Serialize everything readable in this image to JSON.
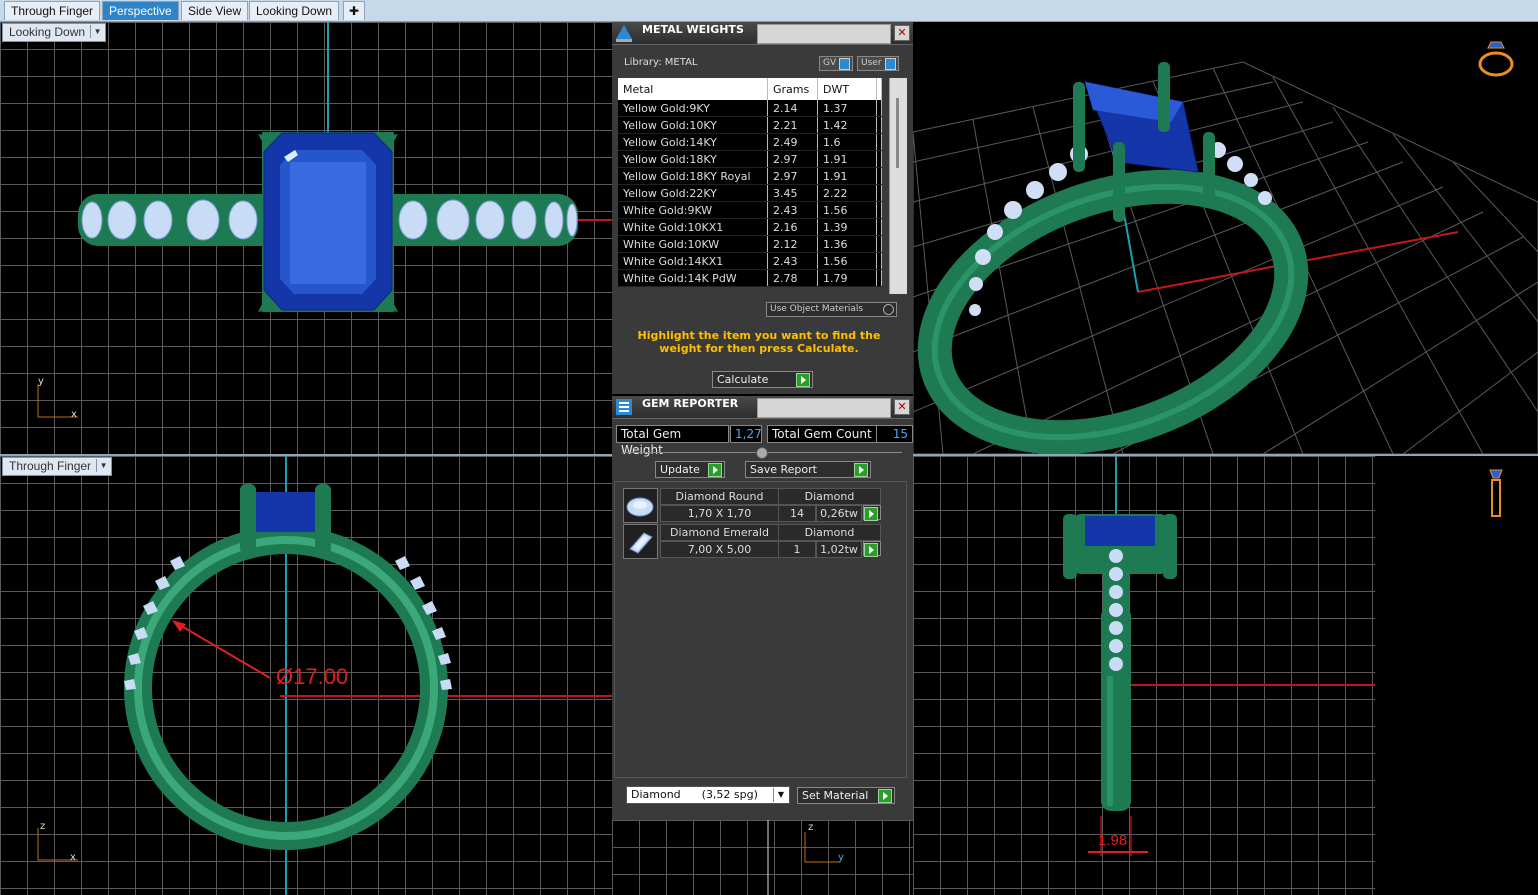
{
  "tabs": [
    {
      "label": "Through Finger",
      "active": false
    },
    {
      "label": "Perspective",
      "active": true
    },
    {
      "label": "Side View",
      "active": false
    },
    {
      "label": "Looking Down",
      "active": false
    }
  ],
  "add_tab_icon": "plus-icon",
  "viewports": {
    "top_left": {
      "label": "Looking Down",
      "axis_v": "y",
      "axis_h": "x"
    },
    "bottom_left": {
      "label": "Through Finger",
      "axis_v": "z",
      "axis_h": "x",
      "dimension": "Ø17.00"
    },
    "bottom_right": {
      "axis_v": "z",
      "axis_h": "y",
      "dimension": "1.98"
    },
    "top_right": {
      "icon": "ring-view-icon"
    }
  },
  "colors": {
    "metal": "#1e7a52",
    "gem": "#1a3fb8",
    "diamond": "#c8dcf5",
    "dimension": "#e02020",
    "axis": "#1aa0b0"
  },
  "metal_weights": {
    "title": "METAL WEIGHTS",
    "library": "Library: METAL",
    "gv_label": "GV",
    "user_label": "User",
    "columns": [
      "Metal",
      "Grams",
      "DWT"
    ],
    "rows": [
      [
        "Yellow Gold:9KY",
        "2.14",
        "1.37"
      ],
      [
        "Yellow Gold:10KY",
        "2.21",
        "1.42"
      ],
      [
        "Yellow Gold:14KY",
        "2.49",
        "1.6"
      ],
      [
        "Yellow Gold:18KY",
        "2.97",
        "1.91"
      ],
      [
        "Yellow Gold:18KY Royal",
        "2.97",
        "1.91"
      ],
      [
        "Yellow Gold:22KY",
        "3.45",
        "2.22"
      ],
      [
        "White Gold:9KW",
        "2.43",
        "1.56"
      ],
      [
        "White Gold:10KX1",
        "2.16",
        "1.39"
      ],
      [
        "White Gold:10KW",
        "2.12",
        "1.36"
      ],
      [
        "White Gold:14KX1",
        "2.43",
        "1.56"
      ],
      [
        "White Gold:14K PdW",
        "2.78",
        "1.79"
      ]
    ],
    "use_object_materials": "Use Object Materials",
    "hint": "Highlight the item you want to find the weight for then press Calculate.",
    "calculate": "Calculate"
  },
  "gem_reporter": {
    "title": "GEM REPORTER",
    "total_weight_label": "Total Gem Weight",
    "total_weight_value": "1,27",
    "total_count_label": "Total Gem Count",
    "total_count_value": "15",
    "update": "Update",
    "save_report": "Save Report",
    "gems": [
      {
        "name": "Diamond Round",
        "material": "Diamond",
        "size": "1,70 X 1,70",
        "count": "14",
        "weight": "0,26tw",
        "icon": "round-gem-icon"
      },
      {
        "name": "Diamond Emerald",
        "material": "Diamond",
        "size": "7,00 X 5,00",
        "count": "1",
        "weight": "1,02tw",
        "icon": "emerald-gem-icon"
      }
    ],
    "material_select": "Diamond      (3,52 spg)",
    "set_material": "Set Material"
  }
}
